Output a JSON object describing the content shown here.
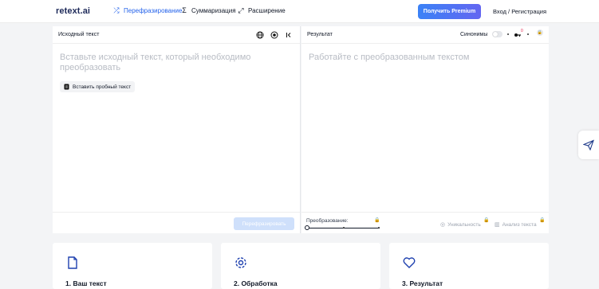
{
  "header": {
    "logo_brand": "retext",
    "logo_suffix": ".ai",
    "nav": [
      {
        "label": "Перефразирование",
        "icon": "shuffle-icon",
        "glyph": "⤮"
      },
      {
        "label": "Суммаризация",
        "icon": "sigma-icon",
        "glyph": "Σ"
      },
      {
        "label": "Расширение",
        "icon": "expand-icon",
        "glyph": "⤢"
      }
    ],
    "premium_label": "Получить Premium",
    "login_label": "Вход / Регистрация"
  },
  "source_panel": {
    "title": "Исходный текст",
    "placeholder": "Вставьте исходный текст, который необходимо преобразовать",
    "sample_button": "Вставить пробный текст",
    "convert_button": "Перефразировать"
  },
  "result_panel": {
    "title": "Результат",
    "synonyms_label": "Синонимы",
    "badge_count": "0",
    "placeholder": "Работайте с преобразованным текстом",
    "transform_label": "Преобразование:",
    "uniqueness_label": "Уникальность",
    "analysis_label": "Анализ текста"
  },
  "steps": [
    {
      "title": "1. Ваш текст",
      "icon": "document-icon"
    },
    {
      "title": "2. Обработка",
      "icon": "gear-icon"
    },
    {
      "title": "3. Результат",
      "icon": "heart-icon"
    }
  ],
  "colors": {
    "accent": "#2563eb",
    "premium_start": "#3b82f6",
    "premium_end": "#6366f1",
    "background": "#f3f4f6"
  }
}
